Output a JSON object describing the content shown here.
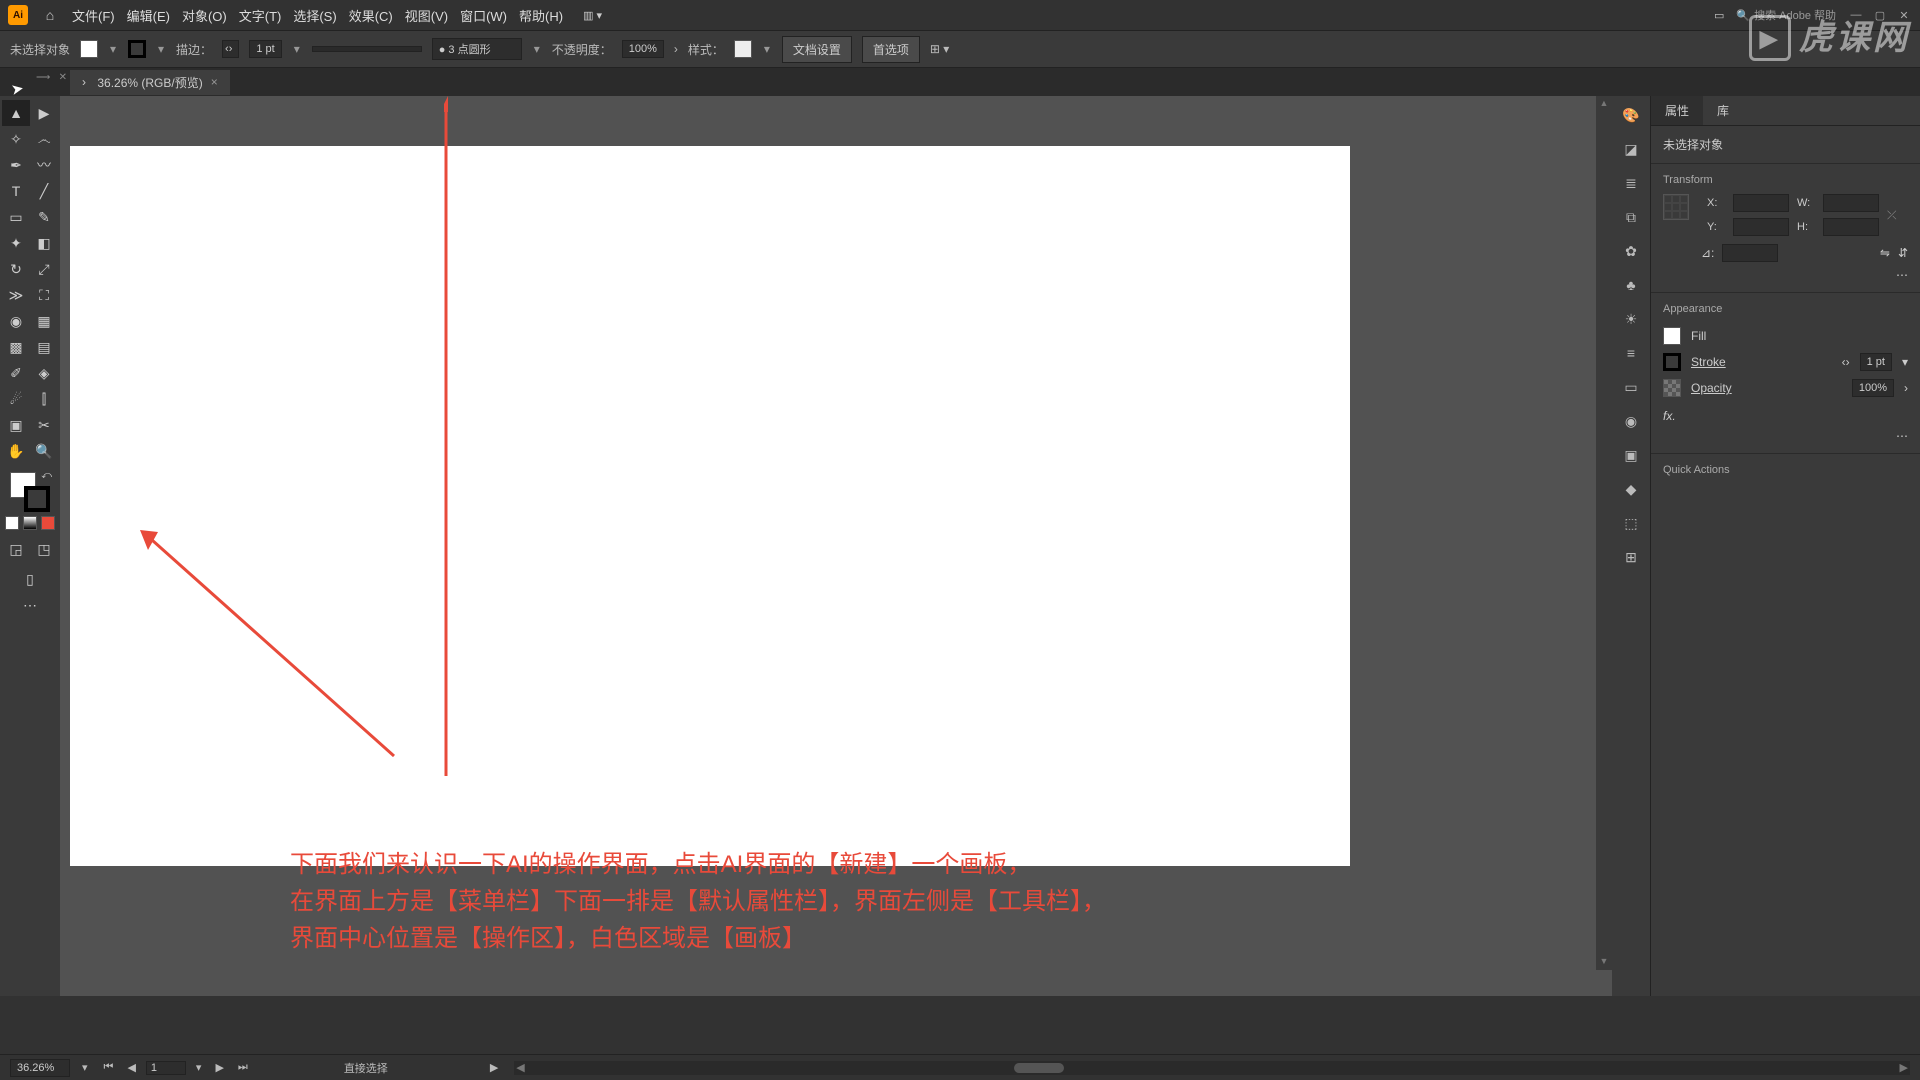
{
  "menu": {
    "items": [
      "文件(F)",
      "编辑(E)",
      "对象(O)",
      "文字(T)",
      "选择(S)",
      "效果(C)",
      "视图(V)",
      "窗口(W)",
      "帮助(H)"
    ]
  },
  "search": {
    "placeholder": "搜索 Adobe 帮助"
  },
  "ctlbar": {
    "no_sel": "未选择对象",
    "stroke_label": "描边：",
    "stroke_val": "1 pt",
    "brush_val": "3 点圆形",
    "opacity_label": "不透明度：",
    "opacity_val": "100%",
    "style_label": "样式：",
    "doc_setup": "文档设置",
    "prefs": "首选项"
  },
  "tab": {
    "title": "36.26% (RGB/预览)"
  },
  "panels": {
    "tabs": [
      "属性",
      "库"
    ],
    "no_sel": "未选择对象",
    "transform": {
      "title": "Transform",
      "x": "X:",
      "y": "Y:",
      "w": "W:",
      "h": "H:",
      "angle": "⊿:"
    },
    "appearance": {
      "title": "Appearance",
      "fill": "Fill",
      "stroke": "Stroke",
      "stroke_val": "1 pt",
      "opacity": "Opacity",
      "opacity_val": "100%",
      "fx": "fx."
    },
    "quick": "Quick Actions"
  },
  "annotation": {
    "line1": "下面我们来认识一下AI的操作界面，点击AI界面的【新建】一个画板，",
    "line2": "在界面上方是【菜单栏】下面一排是【默认属性栏】，界面左侧是【工具栏】，",
    "line3": "界面中心位置是【操作区】，白色区域是【画板】"
  },
  "status": {
    "zoom": "36.26%",
    "artboard_no": "1",
    "tool": "直接选择"
  },
  "watermark": "虎课网"
}
